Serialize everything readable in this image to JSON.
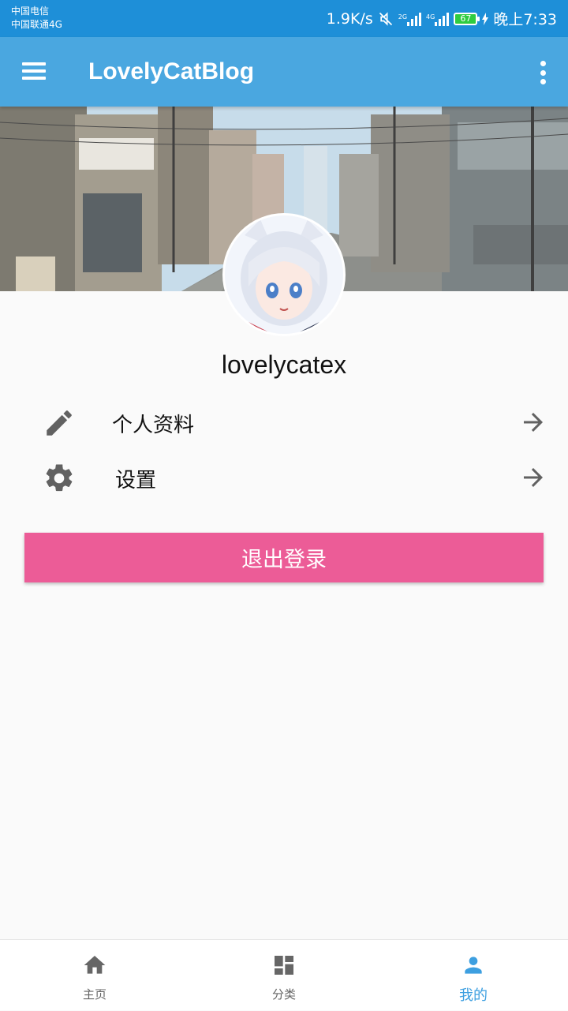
{
  "status_bar": {
    "carrier_1": "中国电信",
    "carrier_2": "中国联通4G",
    "speed": "1.9K/s",
    "net_2g": "2G",
    "net_4g": "4G",
    "battery": "67",
    "time": "晚上7:33"
  },
  "app_bar": {
    "title": "LovelyCatBlog",
    "menu_icon": "hamburger-menu-icon",
    "overflow_icon": "more-vert-icon"
  },
  "profile": {
    "username": "lovelycatex"
  },
  "menu": [
    {
      "label": "个人资料",
      "icon": "edit-pencil-icon",
      "arrow": "arrow-right-icon"
    },
    {
      "label": "设置",
      "icon": "settings-gear-icon",
      "arrow": "arrow-right-icon"
    }
  ],
  "logout_label": "退出登录",
  "bottom_nav": [
    {
      "label": "主页",
      "icon": "home-icon",
      "active": false
    },
    {
      "label": "分类",
      "icon": "dashboard-icon",
      "active": false
    },
    {
      "label": "我的",
      "icon": "person-icon",
      "active": true
    }
  ],
  "colors": {
    "status_bar": "#1e8fd8",
    "app_bar": "#4aa7e0",
    "logout_button": "#ec5c97",
    "nav_active": "#3d9fe0",
    "nav_inactive": "#666666",
    "icon_gray": "#616161"
  }
}
